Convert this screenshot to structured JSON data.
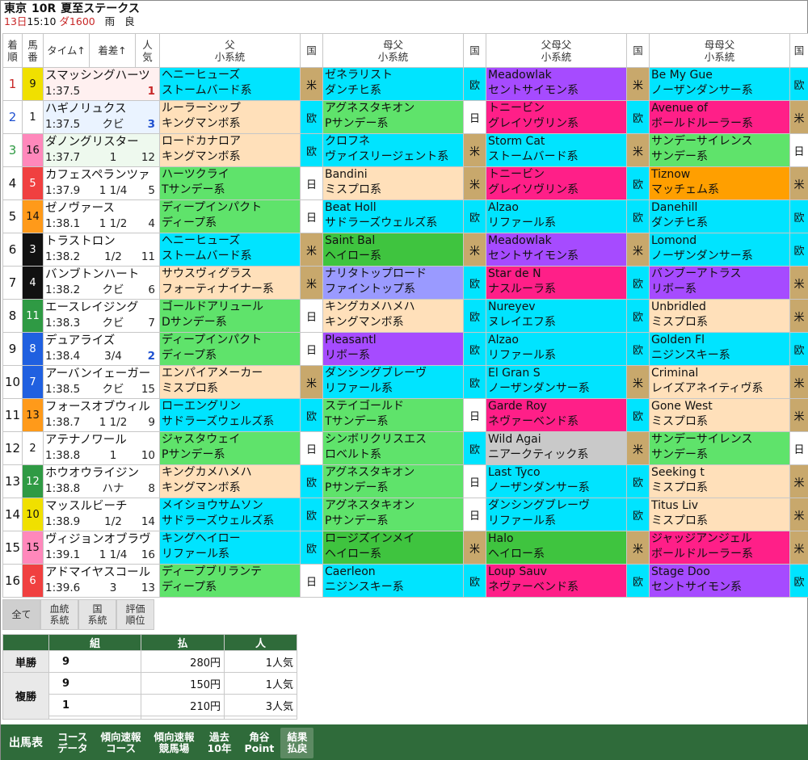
{
  "race": {
    "place": "東京",
    "race_no": "10R",
    "name": "夏至ステークス",
    "date": "13日",
    "time": "15:10",
    "course": "ダ1600",
    "weather": "雨",
    "going": "良"
  },
  "headers": {
    "pos": "着\n順",
    "num": "馬\n番",
    "time_sort": "タイム↑",
    "margin_sort": "着差↑",
    "pop": "人\n気",
    "sire": "父\n小系統",
    "ctry": "国",
    "dam_sire": "母父\n小系統",
    "sire_dam_sire": "父母父\n小系統",
    "dam_dam_sire": "母母父\n小系統"
  },
  "rows": [
    {
      "pos": "1",
      "num": "9",
      "name": "スマッシングハーツ",
      "time": "1:37.5",
      "margin": "",
      "pop": "1",
      "f1": "ヘニーヒューズ",
      "f2": "ストームバード系",
      "fc": "米",
      "m1": "ゼネラリスト",
      "m2": "ダンチヒ系",
      "mc": "欧",
      "p1": "Meadowlak",
      "p2": "セントサイモン系",
      "pc": "米",
      "q1": "Be My Gue",
      "q2": "ノーザンダンサー系",
      "qc": "欧"
    },
    {
      "pos": "2",
      "num": "1",
      "name": "ハギノリュクス",
      "time": "1:37.5",
      "margin": "クビ",
      "pop": "3",
      "f1": "ルーラーシップ",
      "f2": "キングマンボ系",
      "fc": "欧",
      "m1": "アグネスタキオン",
      "m2": "Pサンデー系",
      "mc": "日",
      "p1": "トニービン",
      "p2": "グレイソヴリン系",
      "pc": "欧",
      "q1": "Avenue of",
      "q2": "ボールドルーラー系",
      "qc": "米"
    },
    {
      "pos": "3",
      "num": "16",
      "name": "ダノングリスター",
      "time": "1:37.7",
      "margin": "1",
      "pop": "12",
      "f1": "ロードカナロア",
      "f2": "キングマンボ系",
      "fc": "欧",
      "m1": "クロフネ",
      "m2": "ヴァイスリージェント系",
      "mc": "米",
      "p1": "Storm Cat",
      "p2": "ストームバード系",
      "pc": "米",
      "q1": "サンデーサイレンス",
      "q2": "サンデー系",
      "qc": "日"
    },
    {
      "pos": "4",
      "num": "5",
      "name": "カフェスペランツァ",
      "time": "1:37.9",
      "margin": "1 1/4",
      "pop": "5",
      "f1": "ハーツクライ",
      "f2": "Tサンデー系",
      "fc": "日",
      "m1": "Bandini",
      "m2": "ミスプロ系",
      "mc": "米",
      "p1": "トニービン",
      "p2": "グレイソヴリン系",
      "pc": "欧",
      "q1": "Tiznow",
      "q2": "マッチェム系",
      "qc": "米"
    },
    {
      "pos": "5",
      "num": "14",
      "name": "ゼノヴァース",
      "time": "1:38.1",
      "margin": "1 1/2",
      "pop": "4",
      "f1": "ディープインパクト",
      "f2": "ディープ系",
      "fc": "日",
      "m1": "Beat Holl",
      "m2": "サドラーズウェルズ系",
      "mc": "欧",
      "p1": "Alzao",
      "p2": "リファール系",
      "pc": "欧",
      "q1": "Danehill",
      "q2": "ダンチヒ系",
      "qc": "欧"
    },
    {
      "pos": "6",
      "num": "3",
      "name": "トラストロン",
      "time": "1:38.2",
      "margin": "1/2",
      "pop": "11",
      "f1": "ヘニーヒューズ",
      "f2": "ストームバード系",
      "fc": "米",
      "m1": "Saint Bal",
      "m2": "ヘイロー系",
      "mc": "米",
      "p1": "Meadowlak",
      "p2": "セントサイモン系",
      "pc": "米",
      "q1": "Lomond",
      "q2": "ノーザンダンサー系",
      "qc": "欧"
    },
    {
      "pos": "7",
      "num": "4",
      "name": "バンブトンハート",
      "time": "1:38.2",
      "margin": "クビ",
      "pop": "6",
      "f1": "サウスヴィグラス",
      "f2": "フォーティナイナー系",
      "fc": "米",
      "m1": "ナリタトップロード",
      "m2": "ファイントップ系",
      "mc": "欧",
      "p1": "Star de N",
      "p2": "ナスルーラ系",
      "pc": "欧",
      "q1": "バンブーアトラス",
      "q2": "リボー系",
      "qc": "米"
    },
    {
      "pos": "8",
      "num": "11",
      "name": "エースレイジング",
      "time": "1:38.3",
      "margin": "クビ",
      "pop": "7",
      "f1": "ゴールドアリュール",
      "f2": "Dサンデー系",
      "fc": "日",
      "m1": "キングカメハメハ",
      "m2": "キングマンボ系",
      "mc": "欧",
      "p1": "Nureyev",
      "p2": "ヌレイエフ系",
      "pc": "欧",
      "q1": "Unbridled",
      "q2": "ミスプロ系",
      "qc": "米"
    },
    {
      "pos": "9",
      "num": "8",
      "name": "デュアライズ",
      "time": "1:38.4",
      "margin": "3/4",
      "pop": "2",
      "f1": "ディープインパクト",
      "f2": "ディープ系",
      "fc": "日",
      "m1": "Pleasantl",
      "m2": "リボー系",
      "mc": "欧",
      "p1": "Alzao",
      "p2": "リファール系",
      "pc": "欧",
      "q1": "Golden Fl",
      "q2": "ニジンスキー系",
      "qc": "欧"
    },
    {
      "pos": "10",
      "num": "7",
      "name": "アーバンイェーガー",
      "time": "1:38.5",
      "margin": "クビ",
      "pop": "15",
      "f1": "エンパイアメーカー",
      "f2": "ミスプロ系",
      "fc": "米",
      "m1": "ダンシングブレーヴ",
      "m2": "リファール系",
      "mc": "欧",
      "p1": "El Gran S",
      "p2": "ノーザンダンサー系",
      "pc": "米",
      "q1": "Criminal",
      "q2": "レイズアネイティヴ系",
      "qc": "米"
    },
    {
      "pos": "11",
      "num": "13",
      "name": "フォースオブウィル",
      "time": "1:38.7",
      "margin": "1 1/2",
      "pop": "9",
      "f1": "ローエングリン",
      "f2": "サドラーズウェルズ系",
      "fc": "欧",
      "m1": "ステイゴールド",
      "m2": "Tサンデー系",
      "mc": "日",
      "p1": "Garde Roy",
      "p2": "ネヴァーベンド系",
      "pc": "欧",
      "q1": "Gone West",
      "q2": "ミスプロ系",
      "qc": "米"
    },
    {
      "pos": "12",
      "num": "2",
      "name": "アテナノワール",
      "time": "1:38.8",
      "margin": "1",
      "pop": "10",
      "f1": "ジャスタウェイ",
      "f2": "Pサンデー系",
      "fc": "日",
      "m1": "シンボリクリスエス",
      "m2": "ロベルト系",
      "mc": "欧",
      "p1": "Wild Agai",
      "p2": "ニアークティック系",
      "pc": "米",
      "q1": "サンデーサイレンス",
      "q2": "サンデー系",
      "qc": "日"
    },
    {
      "pos": "13",
      "num": "12",
      "name": "ホウオウライジン",
      "time": "1:38.8",
      "margin": "ハナ",
      "pop": "8",
      "f1": "キングカメハメハ",
      "f2": "キングマンボ系",
      "fc": "欧",
      "m1": "アグネスタキオン",
      "m2": "Pサンデー系",
      "mc": "日",
      "p1": "Last Tyco",
      "p2": "ノーザンダンサー系",
      "pc": "欧",
      "q1": "Seeking t",
      "q2": "ミスプロ系",
      "qc": "米"
    },
    {
      "pos": "14",
      "num": "10",
      "name": "マッスルビーチ",
      "time": "1:38.9",
      "margin": "1/2",
      "pop": "14",
      "f1": "メイショウサムソン",
      "f2": "サドラーズウェルズ系",
      "fc": "欧",
      "m1": "アグネスタキオン",
      "m2": "Pサンデー系",
      "mc": "日",
      "p1": "ダンシングブレーヴ",
      "p2": "リファール系",
      "pc": "欧",
      "q1": "Titus Liv",
      "q2": "ミスプロ系",
      "qc": "米"
    },
    {
      "pos": "15",
      "num": "15",
      "name": "ヴィジョンオブラヴ",
      "time": "1:39.1",
      "margin": "1 1/4",
      "pop": "16",
      "f1": "キングヘイロー",
      "f2": "リファール系",
      "fc": "欧",
      "m1": "ロージズインメイ",
      "m2": "ヘイロー系",
      "mc": "米",
      "p1": "Halo",
      "p2": "ヘイロー系",
      "pc": "米",
      "q1": "ジャッジアンジェル",
      "q2": "ボールドルーラー系",
      "qc": "米"
    },
    {
      "pos": "16",
      "num": "6",
      "name": "アドマイヤスコール",
      "time": "1:39.6",
      "margin": "3",
      "pop": "13",
      "f1": "ディープブリランテ",
      "f2": "ディープ系",
      "fc": "日",
      "m1": "Caerleon",
      "m2": "ニジンスキー系",
      "mc": "欧",
      "p1": "Loup Sauv",
      "p2": "ネヴァーベンド系",
      "pc": "欧",
      "q1": "Stage Doo",
      "q2": "セントサイモン系",
      "qc": "欧"
    }
  ],
  "tabs": [
    {
      "label": "全て"
    },
    {
      "label": "血統\n系統"
    },
    {
      "label": "国\n系統"
    },
    {
      "label": "評価\n順位"
    }
  ],
  "payout": {
    "headers": [
      "組",
      "払",
      "人"
    ],
    "win": {
      "label": "単勝",
      "combo": "9",
      "amount": "280円",
      "pop": "1人気"
    },
    "place": {
      "label": "複勝",
      "items": [
        {
          "combo": "9",
          "amount": "150円",
          "pop": "1人気"
        },
        {
          "combo": "1",
          "amount": "210円",
          "pop": "3人気"
        }
      ]
    }
  },
  "footer": [
    {
      "label": "出馬表"
    },
    {
      "label": "コース\nデータ"
    },
    {
      "label": "傾向速報\nコース"
    },
    {
      "label": "傾向速報\n競馬場"
    },
    {
      "label": "過去\n10年"
    },
    {
      "label": "角谷\nPoint"
    },
    {
      "label": "結果\n払戻"
    }
  ],
  "colors": {
    "header_green": "#2f6b3a",
    "red": "#c82828",
    "blue": "#1e50d0"
  }
}
